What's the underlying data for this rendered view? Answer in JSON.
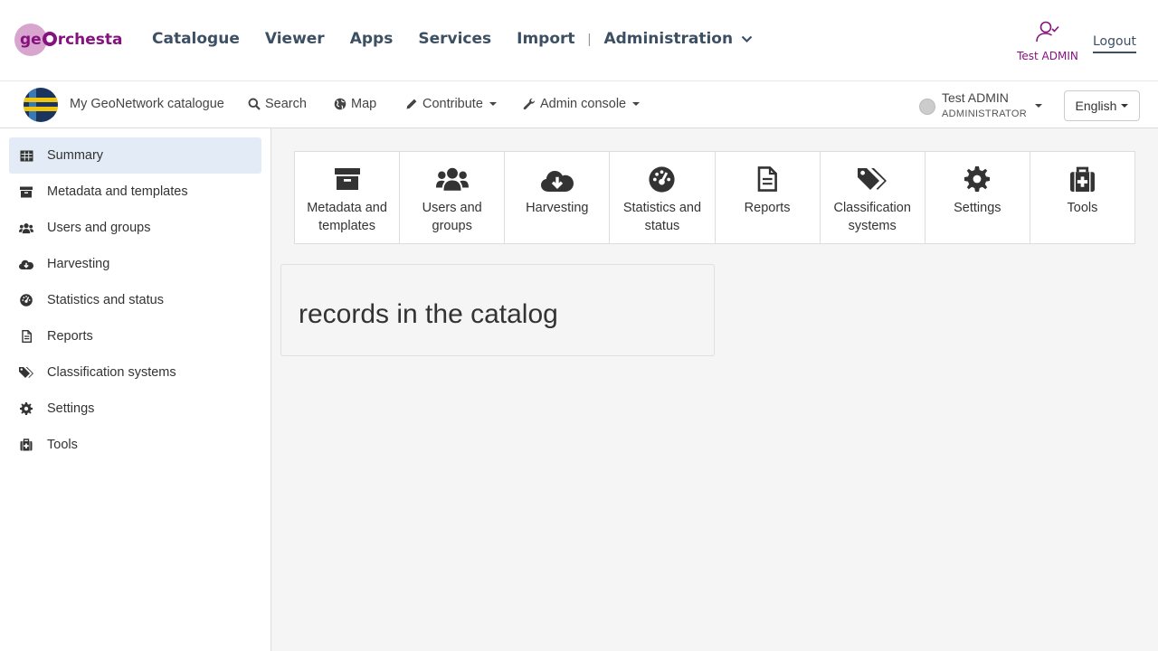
{
  "geo_header": {
    "logo_text_pre": "ge",
    "logo_text_post": "rchesta",
    "nav": [
      "Catalogue",
      "Viewer",
      "Apps",
      "Services",
      "Import"
    ],
    "separator": "|",
    "admin_label": "Administration",
    "user_label": "Test ADMIN",
    "logout_label": "Logout",
    "brand_color": "#85127e"
  },
  "gn_bar": {
    "catalogue_name": "My GeoNetwork catalogue",
    "search_label": "Search",
    "map_label": "Map",
    "contribute_label": "Contribute",
    "admin_console_label": "Admin console",
    "user_name": "Test ADMIN",
    "user_role": "ADMINISTRATOR",
    "language": "English"
  },
  "sidebar": {
    "items": [
      {
        "label": "Summary",
        "icon": "table-icon",
        "active": true
      },
      {
        "label": "Metadata and templates",
        "icon": "archive-icon"
      },
      {
        "label": "Users and groups",
        "icon": "users-icon"
      },
      {
        "label": "Harvesting",
        "icon": "cloud-download-icon"
      },
      {
        "label": "Statistics and status",
        "icon": "dashboard-icon"
      },
      {
        "label": "Reports",
        "icon": "file-icon"
      },
      {
        "label": "Classification systems",
        "icon": "tags-icon"
      },
      {
        "label": "Settings",
        "icon": "gear-icon"
      },
      {
        "label": "Tools",
        "icon": "medkit-icon"
      }
    ]
  },
  "tiles": [
    {
      "label": "Metadata and templates",
      "icon": "archive-icon"
    },
    {
      "label": "Users and groups",
      "icon": "users-icon"
    },
    {
      "label": "Harvesting",
      "icon": "cloud-download-icon"
    },
    {
      "label": "Statistics and status",
      "icon": "dashboard-icon"
    },
    {
      "label": "Reports",
      "icon": "file-icon"
    },
    {
      "label": "Classification systems",
      "icon": "tags-icon"
    },
    {
      "label": "Settings",
      "icon": "gear-icon"
    },
    {
      "label": "Tools",
      "icon": "medkit-icon"
    }
  ],
  "records_text": "records in the catalog"
}
